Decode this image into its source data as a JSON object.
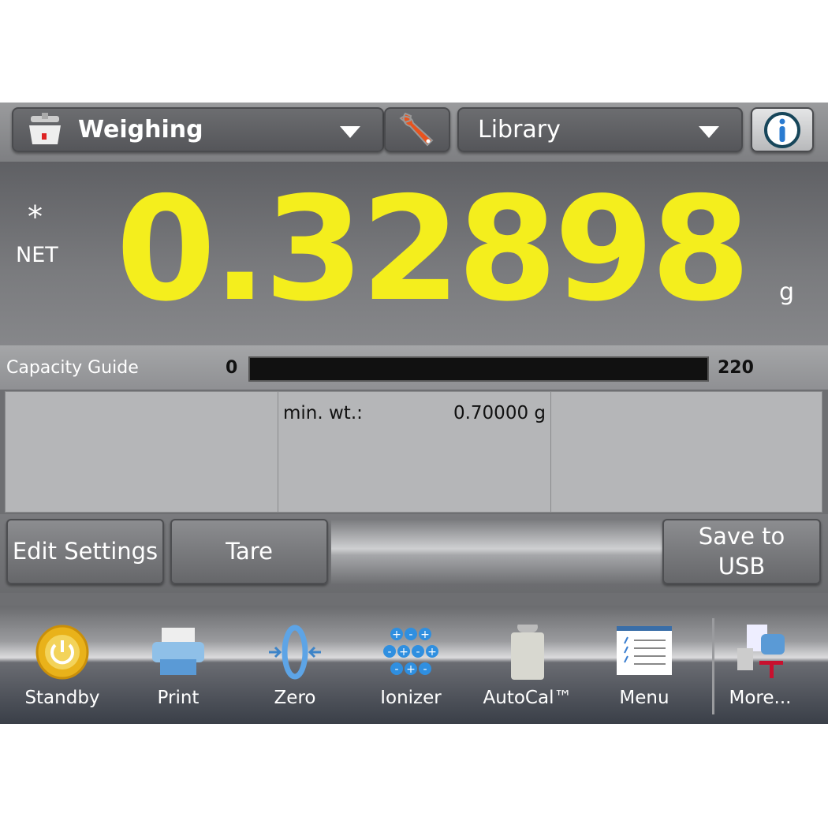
{
  "topbar": {
    "mode": "Weighing",
    "library": "Library",
    "mode_icon": "balance-icon",
    "settings_icon": "wrench-icon",
    "info_icon": "info-icon"
  },
  "reading": {
    "stable_marker": "*",
    "mode_label": "NET",
    "value": "0.32898",
    "unit": "g",
    "color": "#f4ee1d"
  },
  "capacity": {
    "label": "Capacity Guide",
    "min": "0",
    "max": "220",
    "fill_percent": 0
  },
  "info_panel": {
    "min_wt_label": "min. wt.:",
    "min_wt_value": "0.70000 g"
  },
  "buttons": {
    "edit_settings": "Edit Settings",
    "tare": "Tare",
    "save_line1": "Save to",
    "save_line2": "USB"
  },
  "toolbar": [
    {
      "label": "Standby",
      "icon": "power-icon"
    },
    {
      "label": "Print",
      "icon": "printer-icon"
    },
    {
      "label": "Zero",
      "icon": "zero-icon"
    },
    {
      "label": "Ionizer",
      "icon": "ionizer-icon"
    },
    {
      "label": "AutoCal™",
      "icon": "calibration-weight-icon"
    },
    {
      "label": "Menu",
      "icon": "menu-icon"
    },
    {
      "label": "More...",
      "icon": "more-icon"
    }
  ]
}
